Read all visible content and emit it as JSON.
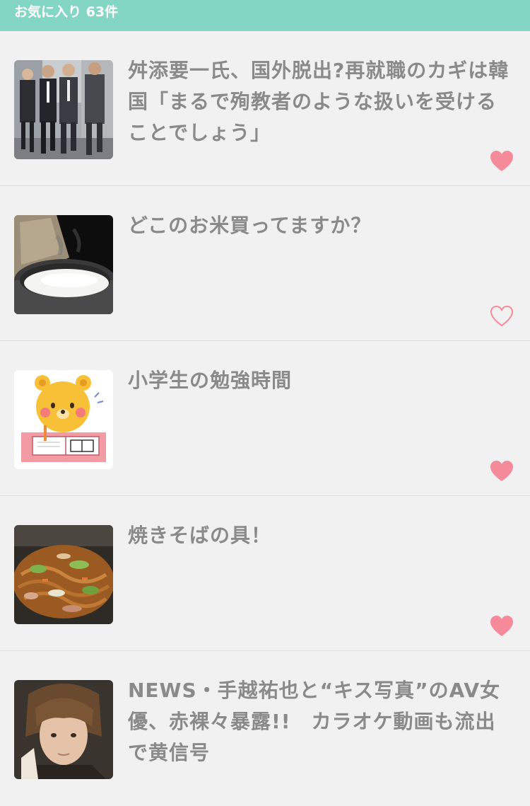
{
  "header": {
    "title": "お気に入り 63件"
  },
  "items": [
    {
      "title": "舛添要一氏、国外脱出?再就職のカギは韓国「まるで殉教者のような扱いを受けることでしょう」",
      "thumbnail": "businessmen-walking-photo",
      "favorited": true
    },
    {
      "title": "どこのお米買ってますか？",
      "thumbnail": "rice-cooker-photo",
      "favorited": false
    },
    {
      "title": "小学生の勉強時間",
      "thumbnail": "bear-studying-illustration",
      "favorited": true
    },
    {
      "title": "焼きそばの具！",
      "thumbnail": "yakisoba-photo",
      "favorited": true
    },
    {
      "title": "NEWS・手越祐也と“キス写真”のAV女優、赤裸々暴露!!　カラオケ動画も流出で黄信号",
      "thumbnail": "singer-portrait-photo",
      "favorited": null
    }
  ],
  "colors": {
    "header_bg": "#84d6c4",
    "header_text": "#ffffff",
    "background": "#f2f1f1",
    "title_text": "#8a8a8a",
    "divider": "#dedddd",
    "heart": "#f48a9a"
  },
  "icons": {
    "heart_filled": "heart-filled-icon",
    "heart_outline": "heart-outline-icon"
  }
}
